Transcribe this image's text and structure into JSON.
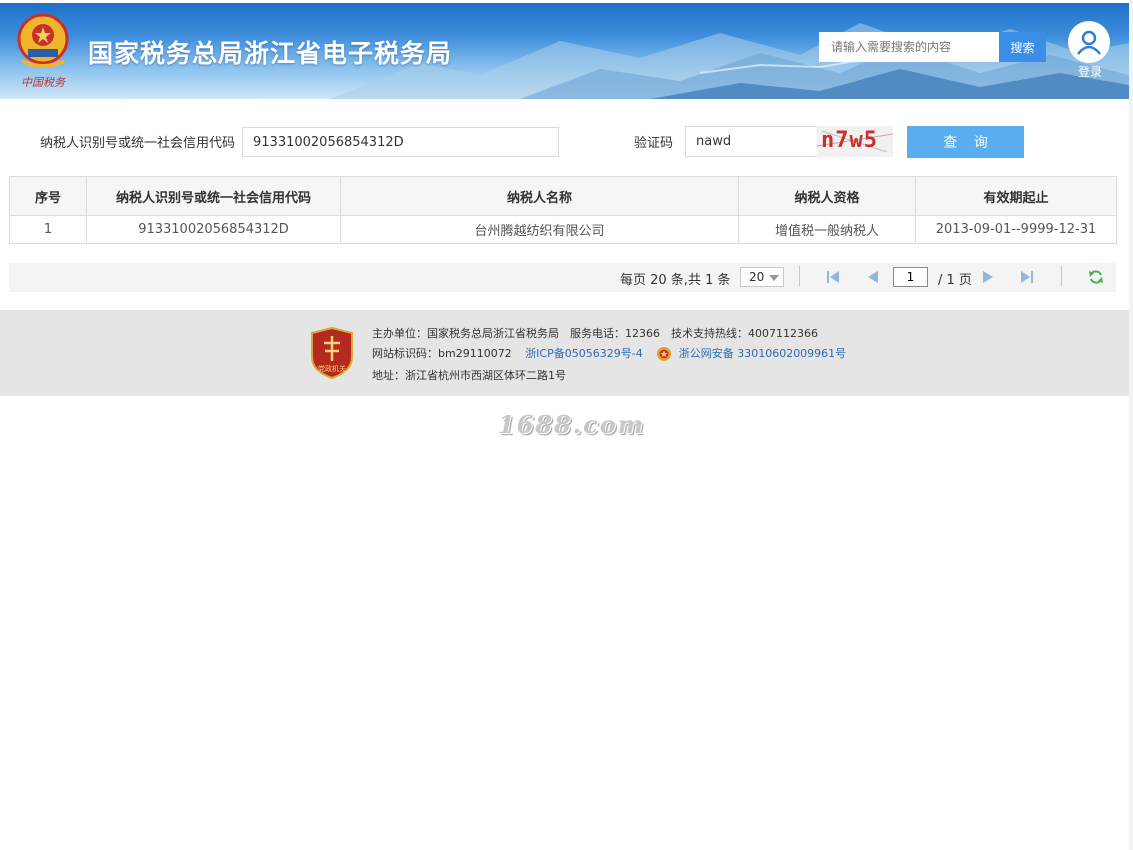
{
  "header": {
    "site_title": "国家税务总局浙江省电子税务局",
    "emblem_caption": "中国税务",
    "search_placeholder": "请输入需要搜索的内容",
    "search_button": "搜索",
    "login_label": "登录"
  },
  "query": {
    "taxpayer_id_label": "纳税人识别号或统一社会信用代码",
    "taxpayer_id_value": "91331002056854312D",
    "captcha_label": "验证码",
    "captcha_value": "nawd",
    "captcha_image_text": "n7w5",
    "query_button": "查 询"
  },
  "table": {
    "columns": [
      "序号",
      "纳税人识别号或统一社会信用代码",
      "纳税人名称",
      "纳税人资格",
      "有效期起止"
    ],
    "rows": [
      [
        "1",
        "91331002056854312D",
        "台州腾越纺织有限公司",
        "增值税一般纳税人",
        "2013-09-01--9999-12-31"
      ]
    ]
  },
  "pager": {
    "summary": "每页 20 条,共 1 条",
    "page_size": "20",
    "current_page": "1",
    "total_pages": "/ 1 页"
  },
  "footer": {
    "line1": "主办单位：国家税务总局浙江省税务局　服务电话：12366　技术支持热线：4007112366",
    "site_id": "网站标识码：bm29110072",
    "icp": "浙ICP备05056329号-4",
    "police": "浙公网安备 33010602009961号",
    "address": "地址：浙江省杭州市西湖区体环二路1号",
    "badge_text": "党政机关"
  },
  "watermark": "1688.com",
  "colors": {
    "header_blue": "#1f6fc9",
    "search_button": "#3a8ee6",
    "query_button": "#5aaef0",
    "captcha_red": "#c9302c",
    "link_blue": "#2b6cb5",
    "badge_red": "#b52a1e"
  }
}
